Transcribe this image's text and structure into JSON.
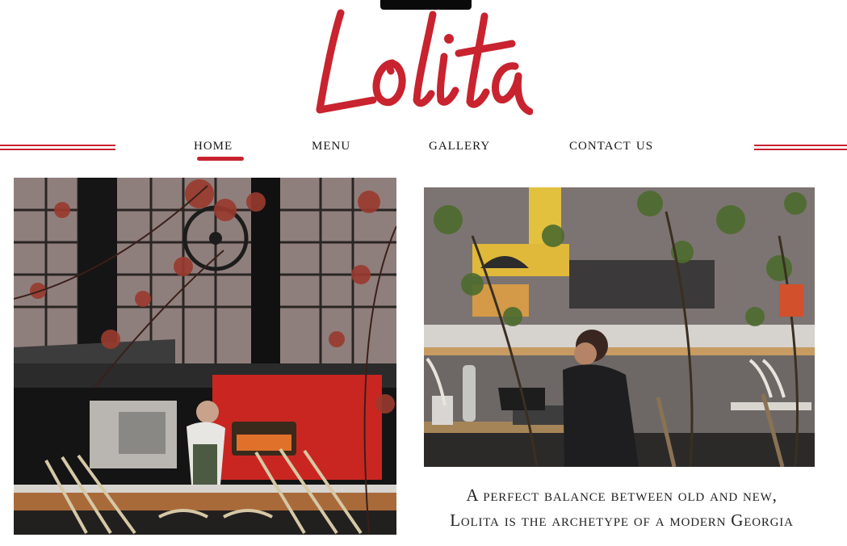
{
  "brand": {
    "name": "Lolita",
    "accent_color": "#c8232f"
  },
  "nav": {
    "items": [
      {
        "label": "HOME",
        "active": true
      },
      {
        "label": "MENU",
        "active": false
      },
      {
        "label": "GALLERY",
        "active": false
      },
      {
        "label": "CONTACT US",
        "active": false
      }
    ]
  },
  "gallery": {
    "left_photo": "restaurant-kitchen-pizza-oven-photo",
    "right_photo": "restaurant-patio-woman-laptop-photo"
  },
  "tagline": {
    "line1": "A perfect balance between old and new,",
    "line2": "Lolita is the archetype of a modern Georgia"
  }
}
